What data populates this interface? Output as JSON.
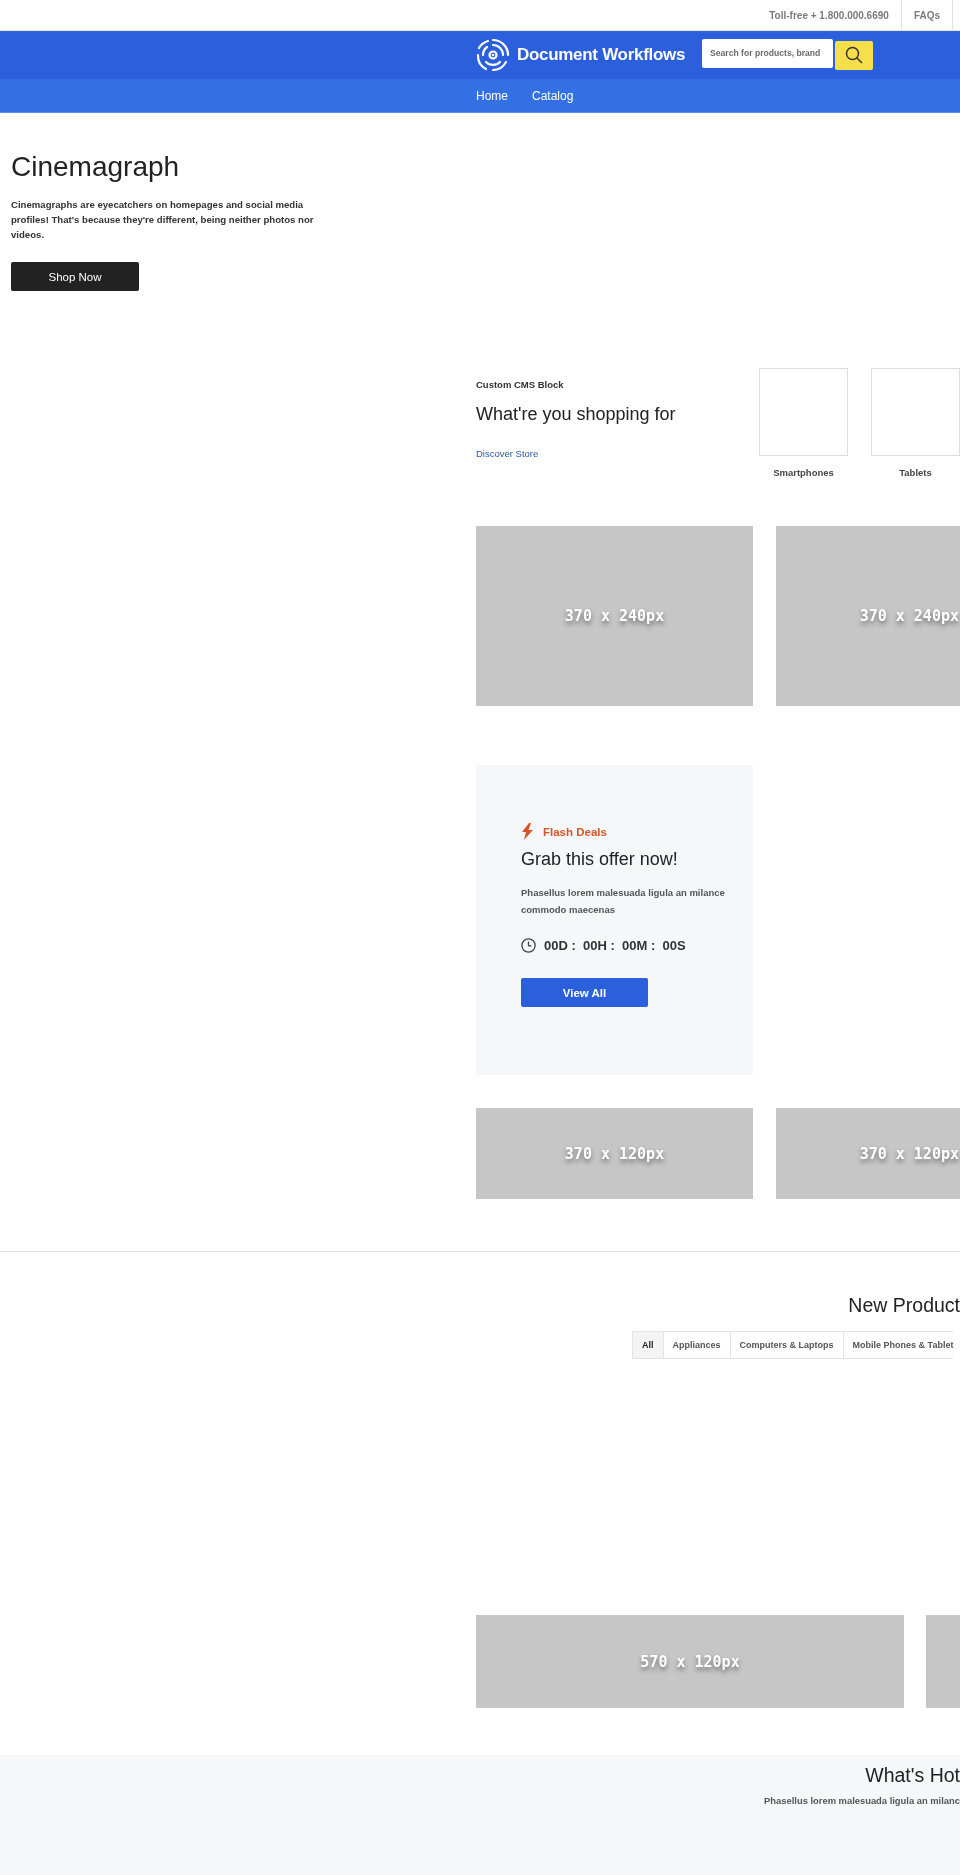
{
  "topbar": {
    "phone": "Toll-free + 1.800.000.6690",
    "links": [
      {
        "label": "FAQs"
      }
    ]
  },
  "header": {
    "logo_text": "Document Workflows",
    "search": {
      "placeholder": "Search for products, brand"
    }
  },
  "nav": [
    {
      "label": "Home"
    },
    {
      "label": "Catalog"
    }
  ],
  "hero": {
    "title": "Cinemagraph",
    "text": "Cinemagraphs are eyecatchers on homepages and social media profiles! That's because they're different, being neither photos nor videos.",
    "button": "Shop Now"
  },
  "cms_block": {
    "eyebrow": "Custom CMS Block",
    "heading": "What're you shopping for",
    "link": "Discover Store",
    "categories": [
      {
        "label": "Smartphones"
      },
      {
        "label": "Tablets"
      }
    ]
  },
  "banners_large": [
    {
      "kind": "labeled",
      "label": "370 x 240px"
    },
    {
      "kind": "labeled",
      "label": "370 x 240px"
    }
  ],
  "flash_deal": {
    "eyebrow": "Flash Deals",
    "heading": "Grab this offer now!",
    "text": "Phasellus lorem malesuada ligula an milance commodo maecenas",
    "countdown": "00D :  00H :  00M :  00S",
    "button": "View All"
  },
  "banners_small": [
    {
      "kind": "labeled",
      "label": "370 x 120px"
    },
    {
      "kind": "labeled",
      "label": "370 x 120px"
    }
  ],
  "new_products": {
    "title": "New Product",
    "tabs": [
      {
        "label": "All",
        "selected": true
      },
      {
        "label": "Appliances",
        "selected": false
      },
      {
        "label": "Computers & Laptops",
        "selected": false
      },
      {
        "label": "Mobile Phones & Tablet",
        "selected": false
      }
    ]
  },
  "banners_wide": [
    {
      "kind": "labeled",
      "label": "570 x 120px"
    },
    {
      "kind": "blank"
    }
  ],
  "whats_hot": {
    "title": "What's Hot",
    "text": "Phasellus lorem malesuada ligula an milanc"
  }
}
